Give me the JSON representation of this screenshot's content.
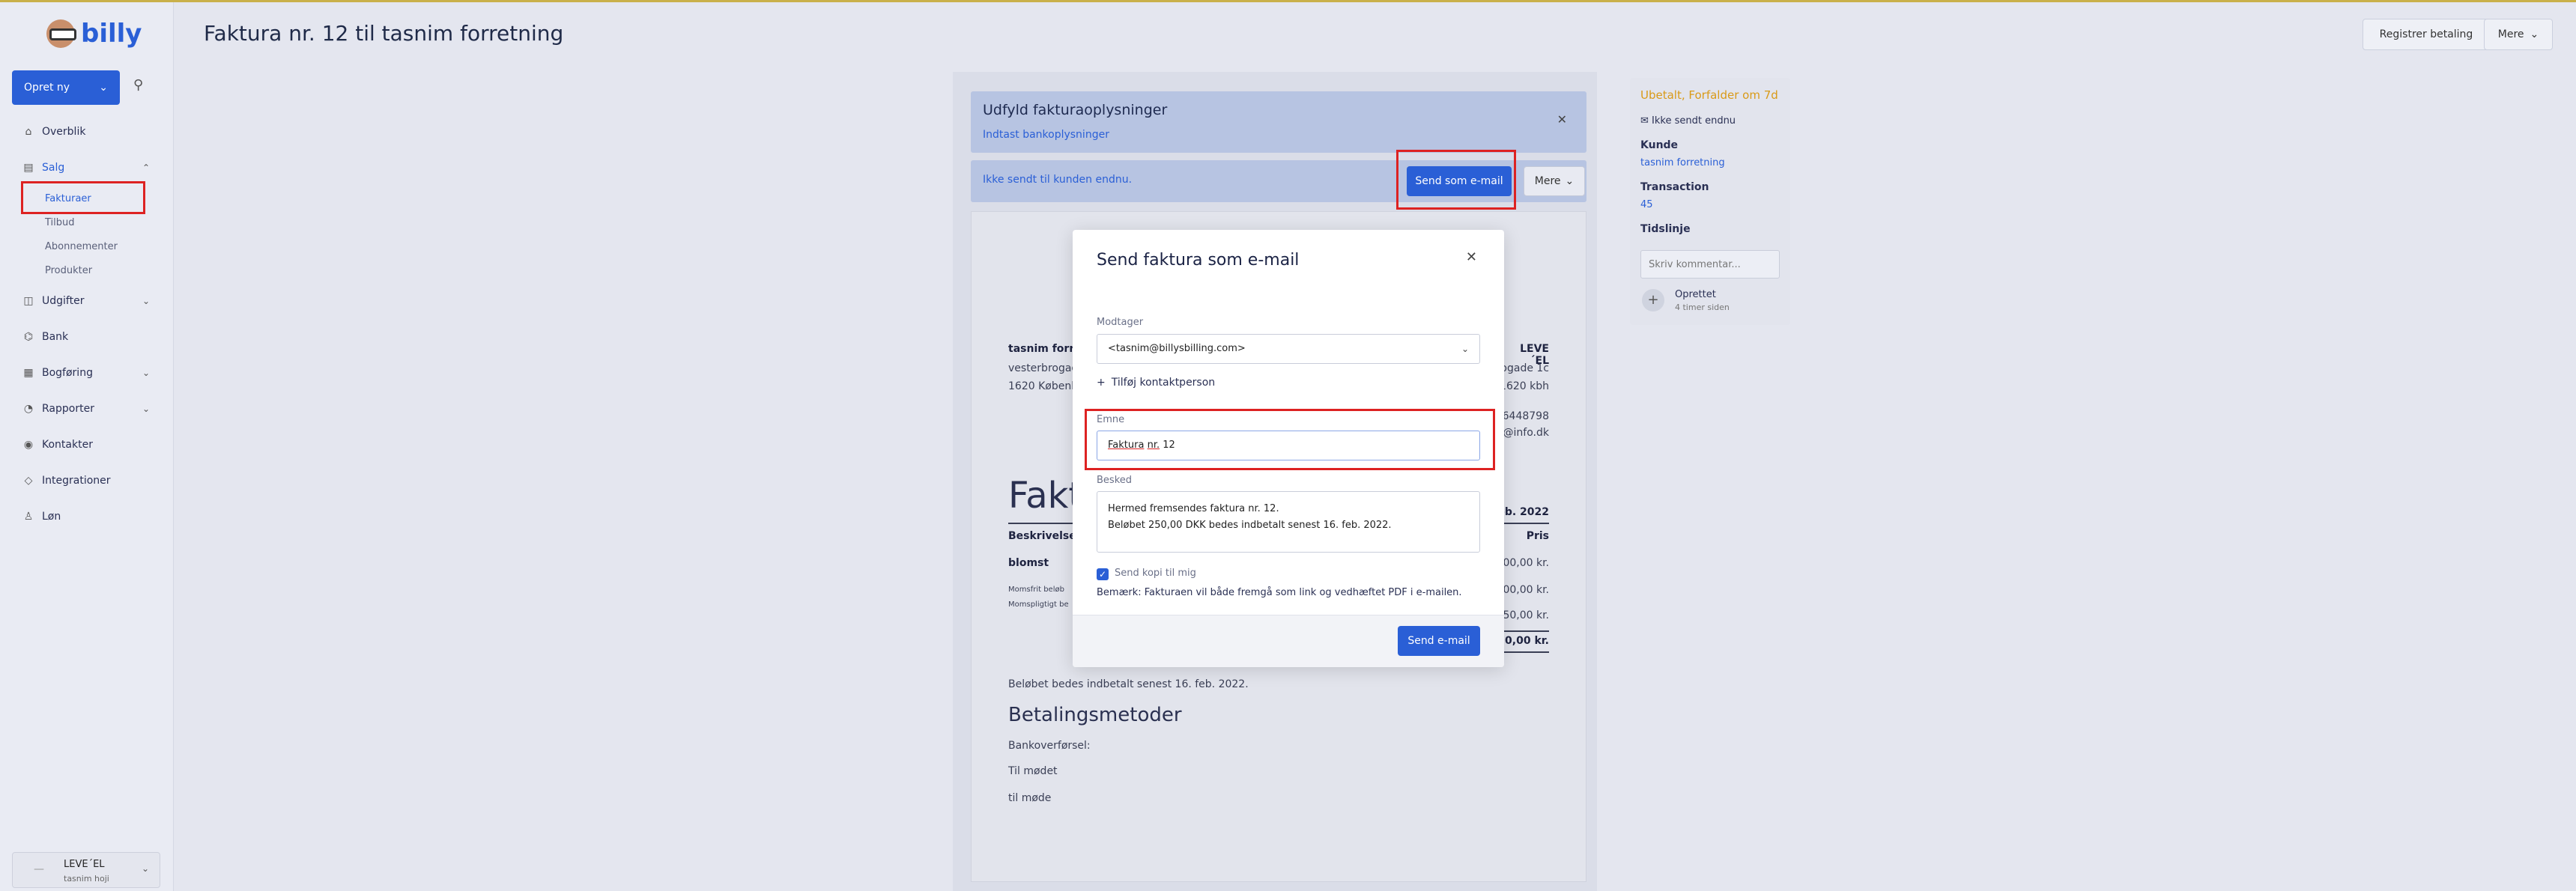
{
  "app": {
    "name": "billy",
    "page_title": "Faktura nr. 12 til tasnim forretning"
  },
  "sidebar": {
    "create_button": "Opret ny",
    "items": [
      {
        "label": "Overblik",
        "icon": "dashboard-icon"
      },
      {
        "label": "Salg",
        "icon": "sales-icon",
        "expanded": true,
        "active": true
      },
      {
        "label": "Udgifter",
        "icon": "expenses-icon"
      },
      {
        "label": "Bank",
        "icon": "bank-icon"
      },
      {
        "label": "Bogføring",
        "icon": "bookkeeping-icon"
      },
      {
        "label": "Rapporter",
        "icon": "reports-icon"
      },
      {
        "label": "Kontakter",
        "icon": "contacts-icon"
      },
      {
        "label": "Integrationer",
        "icon": "integrations-icon"
      },
      {
        "label": "Løn",
        "icon": "payroll-icon"
      }
    ],
    "sales_sub": [
      "Fakturaer",
      "Tilbud",
      "Abonnementer",
      "Produkter"
    ],
    "org": {
      "name": "LEVE´EL",
      "user": "tasnim hoji"
    }
  },
  "header": {
    "register_payment": "Registrer betaling",
    "more": "Mere"
  },
  "notice": {
    "title": "Udfyld fakturaoplysninger",
    "link": "Indtast bankoplysninger",
    "not_sent": "Ikke sendt til kunden endnu.",
    "send_email": "Send som e-mail",
    "more": "Mere"
  },
  "invoice": {
    "customer_name": "tasnim forre",
    "customer_street": "vesterbrogad",
    "customer_city": "1620 Københ",
    "company_name": "LEVE´EL",
    "company_street": "ogade 1c",
    "company_city": "1620 kbh",
    "company_phone": "6448798",
    "company_email": "@info.dk",
    "big_title": "Fakt",
    "date": "feb. 2022",
    "col_desc": "Beskrivelse",
    "col_price": "Pris",
    "item": "blomst",
    "item_price": "00,00 kr.",
    "vat_free": "Momsfrit beløb",
    "vat_liable": "Momspligtigt be",
    "sub1": "200,00 kr.",
    "sub2": "50,00 kr.",
    "total": "250,00 kr.",
    "due_text": "Beløbet bedes indbetalt senest 16. feb. 2022.",
    "methods_title": "Betalingsmetoder",
    "method1": "Bankoverførsel:",
    "method2": "Til mødet",
    "method3": "til møde"
  },
  "right_panel": {
    "status": "Ubetalt, Forfalder om 7d",
    "not_sent": "Ikke sendt endnu",
    "customer_label": "Kunde",
    "customer_link": "tasnim forretning",
    "transaction_label": "Transaction",
    "transaction_value": "45",
    "timeline_label": "Tidslinje",
    "comment_placeholder": "Skriv kommentar...",
    "created": "Oprettet",
    "created_time": "4 timer siden"
  },
  "modal": {
    "title": "Send faktura som e-mail",
    "recipient_label": "Modtager",
    "recipient_value": "<tasnim@billysbilling.com>",
    "add_contact": "Tilføj kontaktperson",
    "subject_label": "Emne",
    "subject_word1": "Faktura",
    "subject_word2": "nr.",
    "subject_word3": "12",
    "message_label": "Besked",
    "message_line1": "Hermed fremsendes faktura nr. 12.",
    "message_line2": "Beløbet 250,00 DKK bedes indbetalt senest 16. feb. 2022.",
    "copy_label": "Send kopi til mig",
    "copy_checked": true,
    "note": "Bemærk: Fakturaen vil både fremgå som link og vedhæftet PDF i e-mailen.",
    "send_button": "Send e-mail"
  }
}
